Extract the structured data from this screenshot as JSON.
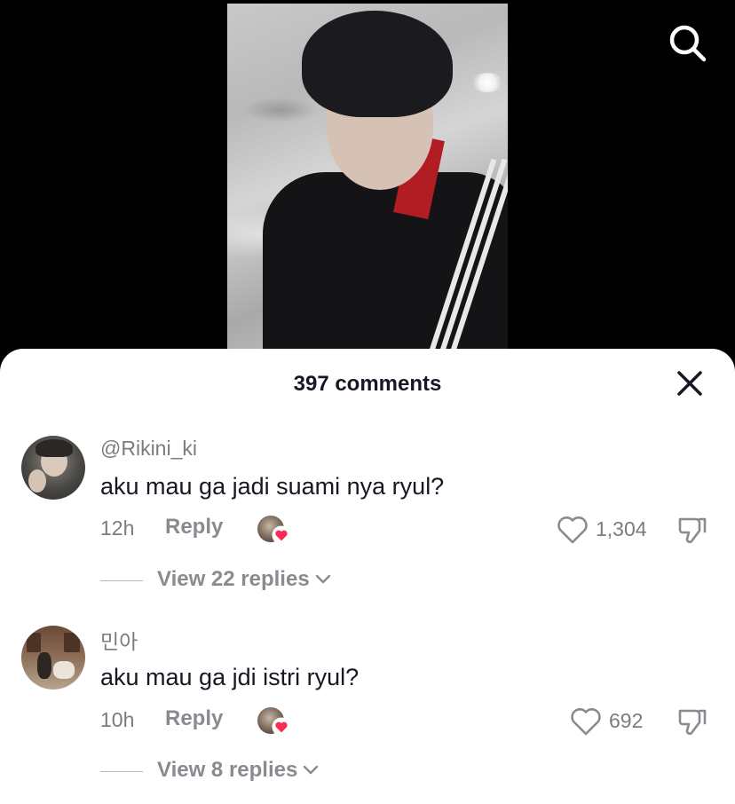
{
  "header": {
    "search_icon": "search-icon"
  },
  "sheet": {
    "title": "397 comments",
    "close_icon": "close-icon"
  },
  "comments": [
    {
      "username": "@Rikini_ki",
      "text": "aku mau ga jadi suami nya ryul?",
      "time": "12h",
      "reply_label": "Reply",
      "like_count": "1,304",
      "view_replies": "View 22 replies",
      "creator_liked": true
    },
    {
      "username": "민아",
      "text": "aku mau ga jdi istri ryul?",
      "time": "10h",
      "reply_label": "Reply",
      "like_count": "692",
      "view_replies": "View 8 replies",
      "creator_liked": true
    }
  ],
  "colors": {
    "heart": "#fe2c55",
    "muted_text": "#7c7c80",
    "primary_text": "#161823"
  }
}
